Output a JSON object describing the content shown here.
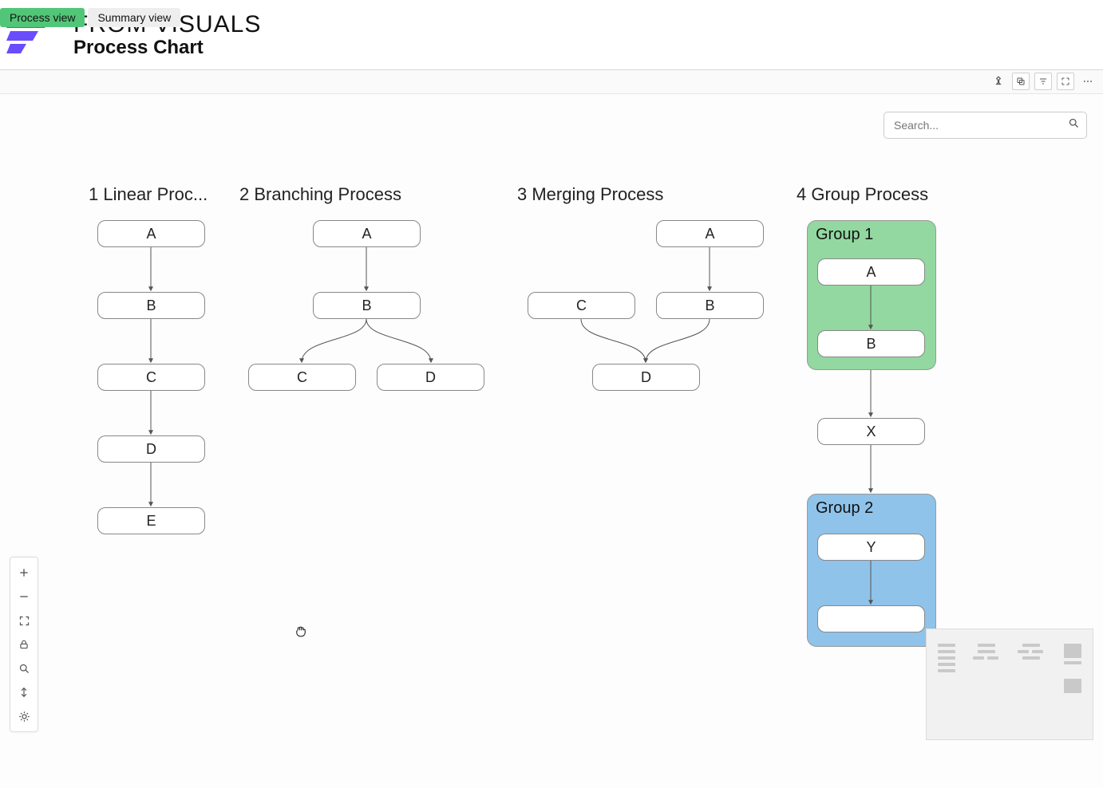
{
  "header": {
    "brand": "FROM VISUALS",
    "subtitle": "Process Chart"
  },
  "tabs": {
    "process": "Process view",
    "summary": "Summary view"
  },
  "search": {
    "placeholder": "Search..."
  },
  "columns": {
    "c1": "1 Linear Proc...",
    "c2": "2 Branching Process",
    "c3": "3 Merging Process",
    "c4": "4 Group Process"
  },
  "groups": {
    "g1": "Group 1",
    "g2": "Group 2"
  },
  "nodes": {
    "l1": "A",
    "l2": "B",
    "l3": "C",
    "l4": "D",
    "l5": "E",
    "b1": "A",
    "b2": "B",
    "b3": "C",
    "b4": "D",
    "m1": "A",
    "m2": "B",
    "m3": "C",
    "m4": "D",
    "g1a": "A",
    "g1b": "B",
    "gx": "X",
    "g2y": "Y",
    "g2z": ""
  }
}
